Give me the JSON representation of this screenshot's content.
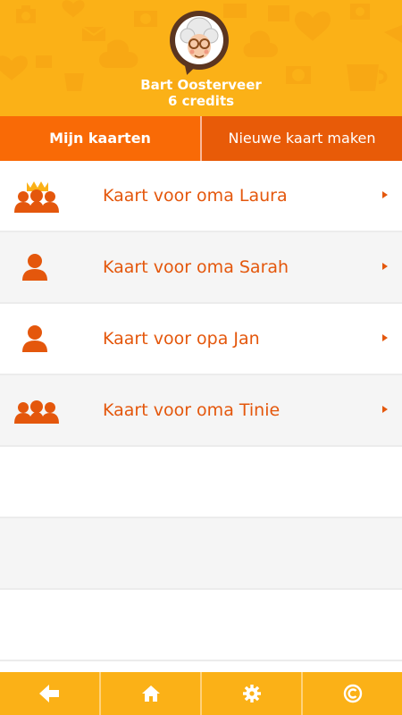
{
  "header": {
    "user_name": "Bart Oosterveer",
    "credits": "6 credits",
    "background_color": "#fbb117"
  },
  "tabs": [
    {
      "label": "Mijn kaarten",
      "active": true
    },
    {
      "label": "Nieuwe kaart maken",
      "active": false
    }
  ],
  "cards": [
    {
      "label": "Kaart voor oma Laura",
      "icon": "group-crown-icon"
    },
    {
      "label": "Kaart voor oma Sarah",
      "icon": "person-icon"
    },
    {
      "label": "Kaart voor opa Jan",
      "icon": "person-icon"
    },
    {
      "label": "Kaart voor oma Tinie",
      "icon": "group-icon"
    }
  ],
  "footer": {
    "buttons": [
      "back-arrow-icon",
      "home-icon",
      "gear-icon",
      "copyright-icon"
    ]
  },
  "colors": {
    "accent": "#f96a06",
    "text": "#e4570c",
    "header": "#fbb117"
  }
}
